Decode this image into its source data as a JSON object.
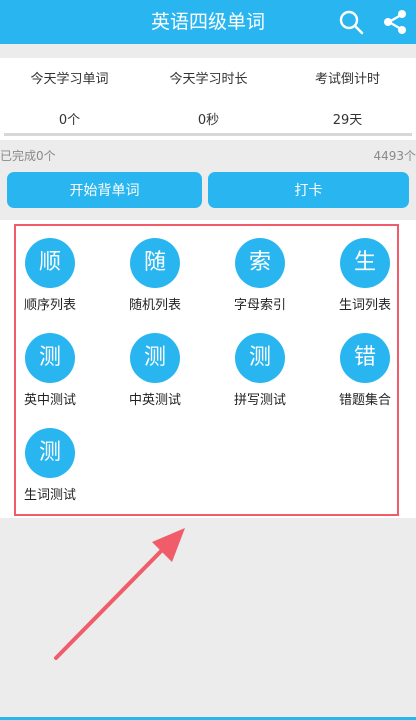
{
  "app": {
    "title": "英语四级单词",
    "colors": {
      "primary": "#29b6f0",
      "highlight": "#f05c6a"
    },
    "icons": [
      "search-icon",
      "share-icon"
    ]
  },
  "stats": [
    {
      "label": "今天学习单词",
      "value": "0个"
    },
    {
      "label": "今天学习时长",
      "value": "0秒"
    },
    {
      "label": "考试倒计时",
      "value": "29天"
    }
  ],
  "progress": {
    "fraction": 0,
    "done_text": "已完成0个",
    "total_text": "4493个"
  },
  "actions": {
    "start_label": "开始背单词",
    "checkin_label": "打卡"
  },
  "grid": [
    {
      "glyph": "顺",
      "label": "顺序列表"
    },
    {
      "glyph": "随",
      "label": "随机列表"
    },
    {
      "glyph": "索",
      "label": "字母索引"
    },
    {
      "glyph": "生",
      "label": "生词列表"
    },
    {
      "glyph": "测",
      "label": "英中测试"
    },
    {
      "glyph": "测",
      "label": "中英测试"
    },
    {
      "glyph": "测",
      "label": "拼写测试"
    },
    {
      "glyph": "错",
      "label": "错题集合"
    },
    {
      "glyph": "测",
      "label": "生词测试"
    }
  ]
}
